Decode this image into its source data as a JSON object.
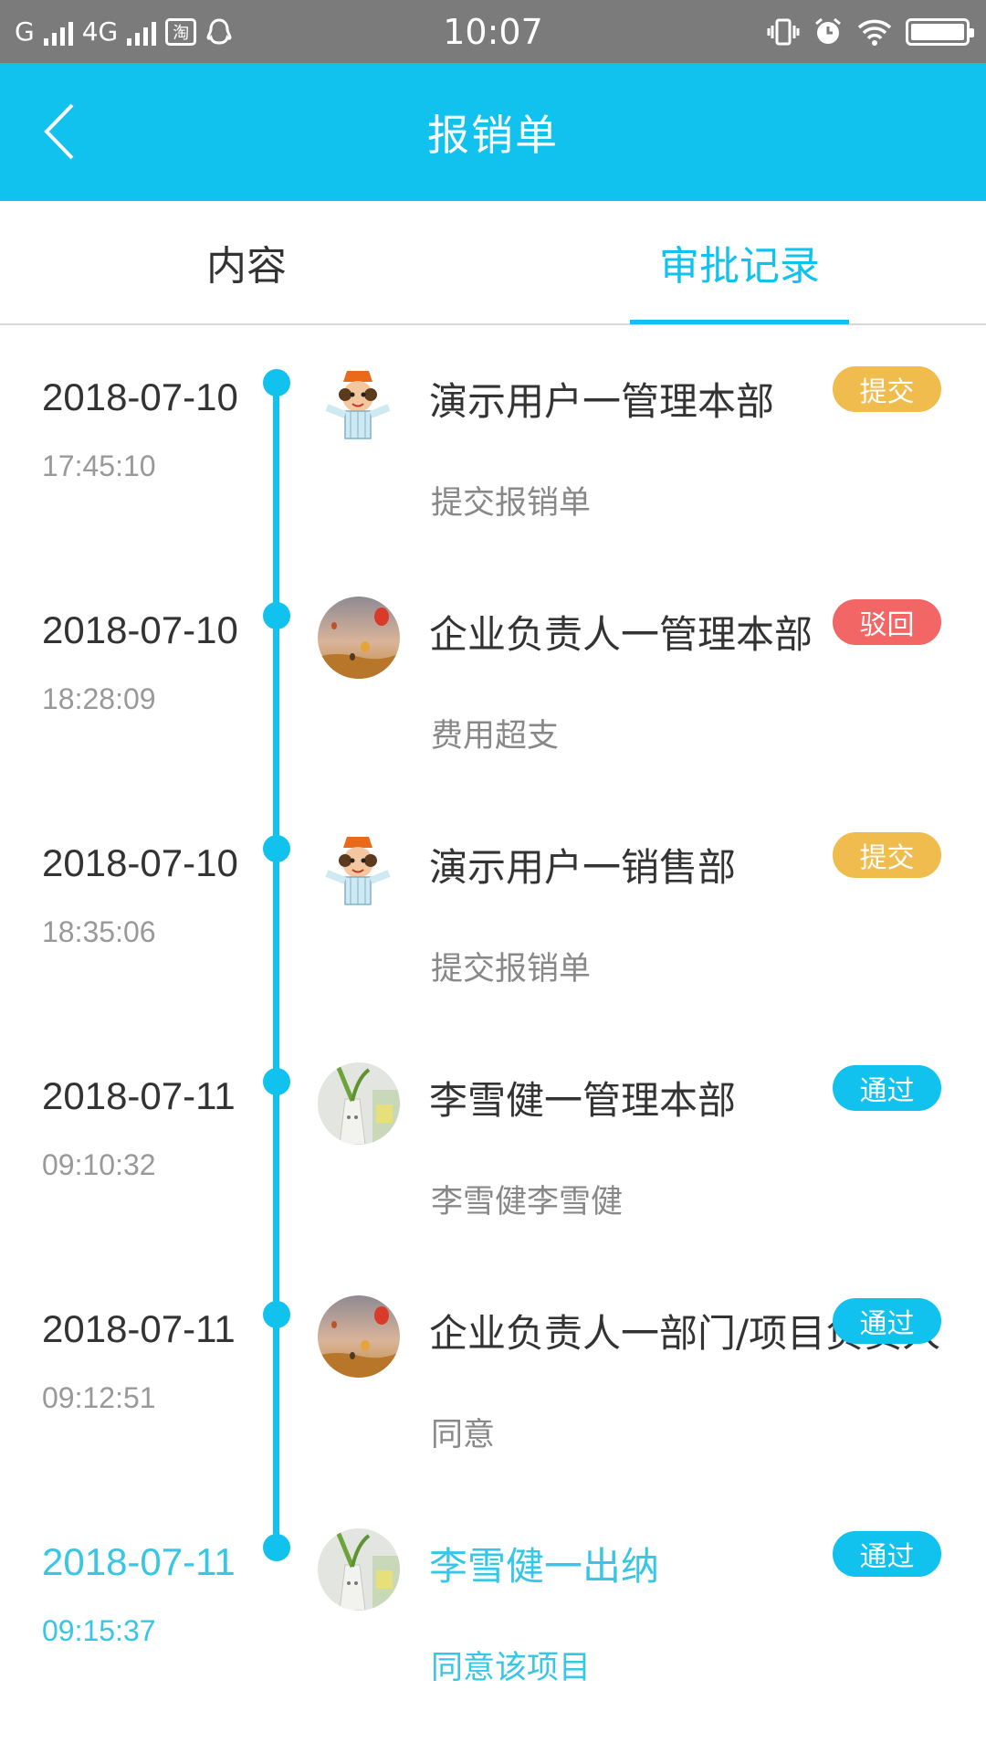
{
  "status_bar": {
    "network": "G",
    "network2": "4G",
    "app_icon": "淘",
    "time": "10:07"
  },
  "header": {
    "title": "报销单"
  },
  "tabs": [
    {
      "label": "内容"
    },
    {
      "label": "审批记录"
    }
  ],
  "colors": {
    "accent": "#12c2ee",
    "submit": "#f0bc4e",
    "reject": "#f26666",
    "approve": "#12c2ee"
  },
  "records": [
    {
      "date": "2018-07-10",
      "time": "17:45:10",
      "name": "演示用户一管理本部",
      "note": "提交报销单",
      "status": "提交",
      "avatar": "cartoon-avatar"
    },
    {
      "date": "2018-07-10",
      "time": "18:28:09",
      "name": "企业负责人一管理本部",
      "note": "费用超支",
      "status": "驳回",
      "avatar": "balloon-avatar"
    },
    {
      "date": "2018-07-10",
      "time": "18:35:06",
      "name": "演示用户一销售部",
      "note": "提交报销单",
      "status": "提交",
      "avatar": "cartoon-avatar"
    },
    {
      "date": "2018-07-11",
      "time": "09:10:32",
      "name": "李雪健一管理本部",
      "note": "李雪健李雪健",
      "status": "通过",
      "avatar": "plant-avatar"
    },
    {
      "date": "2018-07-11",
      "time": "09:12:51",
      "name": "企业负责人一部门/项目负责人",
      "note": "同意",
      "status": "通过",
      "avatar": "balloon-avatar"
    },
    {
      "date": "2018-07-11",
      "time": "09:15:37",
      "name": "李雪健一出纳",
      "note": "同意该项目",
      "status": "通过",
      "avatar": "plant-avatar"
    }
  ]
}
